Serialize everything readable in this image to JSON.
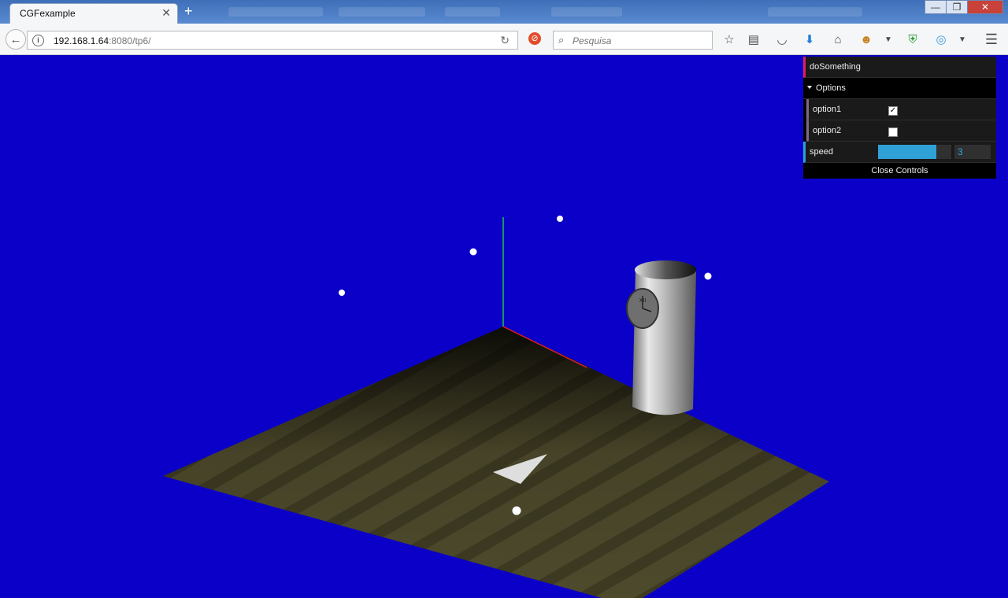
{
  "browser": {
    "tab_title": "CGFexample",
    "tab_close": "✕",
    "new_tab": "+",
    "url_host": "192.168.1.64",
    "url_rest": ":8080/tp6/",
    "search_placeholder": "Pesquisa",
    "window_buttons": {
      "minimize": "—",
      "maximize": "❐",
      "close": "✕"
    }
  },
  "gui": {
    "do_something_label": "doSomething",
    "options_folder_label": "Options",
    "option1_label": "option1",
    "option1_checked": true,
    "option1_mark": "✓",
    "option2_label": "option2",
    "option2_checked": false,
    "speed_label": "speed",
    "speed_value": "3",
    "speed_fill_fraction": 0.8,
    "close_label": "Close Controls"
  },
  "scene": {
    "background_color": "#0a00c8",
    "floor_color": "#4e4a2c",
    "axis_colors": {
      "x": "#e0201e",
      "y": "#1ec64a"
    },
    "clock_numerals": "XII"
  }
}
